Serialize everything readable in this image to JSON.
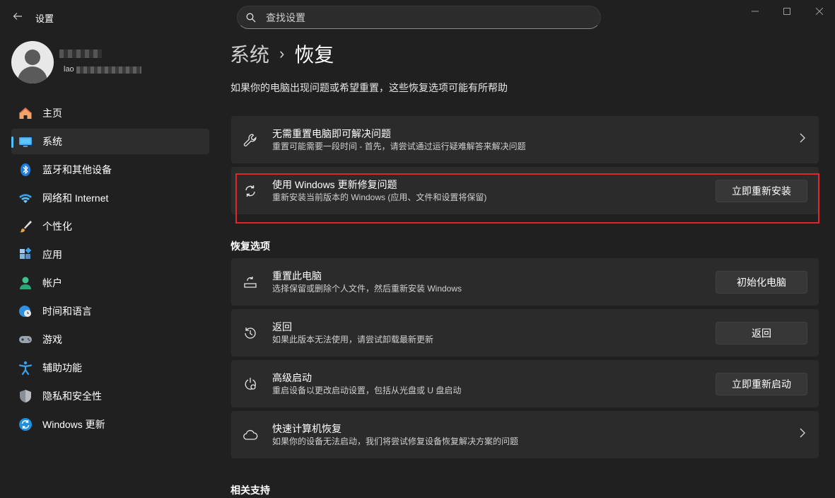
{
  "window": {
    "title": "设置",
    "search_placeholder": "查找设置"
  },
  "profile": {
    "name_partial": "lao"
  },
  "sidebar": {
    "items": [
      {
        "label": "主页",
        "icon": "home-icon"
      },
      {
        "label": "系统",
        "icon": "system-icon",
        "active": true
      },
      {
        "label": "蓝牙和其他设备",
        "icon": "bluetooth-icon"
      },
      {
        "label": "网络和 Internet",
        "icon": "wifi-icon"
      },
      {
        "label": "个性化",
        "icon": "brush-icon"
      },
      {
        "label": "应用",
        "icon": "apps-icon"
      },
      {
        "label": "帐户",
        "icon": "account-icon"
      },
      {
        "label": "时间和语言",
        "icon": "globe-clock-icon"
      },
      {
        "label": "游戏",
        "icon": "gamepad-icon"
      },
      {
        "label": "辅助功能",
        "icon": "accessibility-icon"
      },
      {
        "label": "隐私和安全性",
        "icon": "shield-icon"
      },
      {
        "label": "Windows 更新",
        "icon": "update-icon"
      }
    ]
  },
  "main": {
    "breadcrumb": {
      "parent": "系统",
      "separator": "›",
      "current": "恢复"
    },
    "subtitle": "如果你的电脑出现问题或希望重置，这些恢复选项可能有所帮助",
    "top_cards": [
      {
        "title": "无需重置电脑即可解决问题",
        "desc": "重置可能需要一段时间 - 首先，请尝试通过运行疑难解答来解决问题",
        "icon": "wrench-icon"
      },
      {
        "title": "使用 Windows 更新修复问题",
        "desc": "重新安装当前版本的 Windows (应用、文件和设置将保留)",
        "button": "立即重新安装",
        "icon": "sync-icon"
      }
    ],
    "recovery_heading": "恢复选项",
    "recovery_cards": [
      {
        "title": "重置此电脑",
        "desc": "选择保留或删除个人文件，然后重新安装 Windows",
        "button": "初始化电脑",
        "icon": "reset-pc-icon"
      },
      {
        "title": "返回",
        "desc": "如果此版本无法使用，请尝试卸载最新更新",
        "button": "返回",
        "icon": "history-icon"
      },
      {
        "title": "高级启动",
        "desc": "重启设备以更改启动设置，包括从光盘或 U 盘启动",
        "button": "立即重新启动",
        "icon": "advanced-startup-icon"
      },
      {
        "title": "快速计算机恢复",
        "desc": "如果你的设备无法启动，我们将尝试修复设备恢复解决方案的问题",
        "icon": "cloud-icon"
      }
    ],
    "related_heading": "相关支持"
  },
  "colors": {
    "background": "#202020",
    "card": "#2b2b2b",
    "accent": "#4cc2ff",
    "highlight": "#e0262a"
  }
}
